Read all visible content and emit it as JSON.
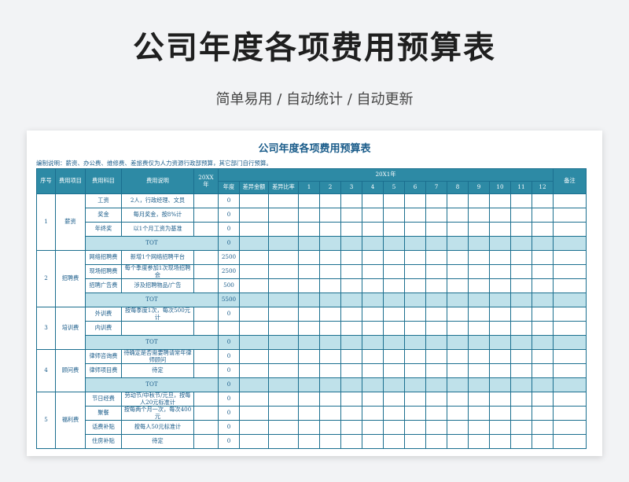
{
  "hero": {
    "title": "公司年度各项费用预算表",
    "subtitle": "简单易用  /  自动统计  /  自动更新"
  },
  "sheet": {
    "title": "公司年度各项费用预算表",
    "note": "编制说明：薪资、办公费、维修费、差旅费仅为人力资源行政部预算，其它部门自行预算。",
    "headers": {
      "seq": "序号",
      "project": "费用项目",
      "subject": "费用科目",
      "desc": "费用说明",
      "prev_year": "20XX年",
      "cur_year": "20X1年",
      "remark": "备注",
      "annual": "年度",
      "diff_amount": "差异金额",
      "diff_ratio": "差异比率",
      "months": [
        "1",
        "2",
        "3",
        "4",
        "5",
        "6",
        "7",
        "8",
        "9",
        "10",
        "11",
        "12"
      ]
    },
    "groups": [
      {
        "seq": "1",
        "project": "薪资",
        "items": [
          {
            "subject": "工资",
            "desc": "2人，行政经理、文员",
            "annual": "0"
          },
          {
            "subject": "奖金",
            "desc": "每月奖金，按8%计",
            "annual": "0"
          },
          {
            "subject": "年终奖",
            "desc": "以1个月工资为基准",
            "annual": "0"
          }
        ],
        "tot_label": "TOT",
        "tot_value": "0"
      },
      {
        "seq": "2",
        "project": "招聘费",
        "items": [
          {
            "subject": "网络招聘费",
            "desc": "新增1个网络招聘平台",
            "annual": "2500"
          },
          {
            "subject": "现场招聘费",
            "desc": "每个季度参加1次现场招聘会",
            "annual": "2500"
          },
          {
            "subject": "招聘广告费",
            "desc": "涉及招聘物品/广告",
            "annual": "500"
          }
        ],
        "tot_label": "TOT",
        "tot_value": "5500"
      },
      {
        "seq": "3",
        "project": "培训费",
        "items": [
          {
            "subject": "外训费",
            "desc": "按每季度1次，每次500元计",
            "annual": "0"
          },
          {
            "subject": "内训费",
            "desc": "",
            "annual": ""
          }
        ],
        "tot_label": "TOT",
        "tot_value": "0"
      },
      {
        "seq": "4",
        "project": "顾问费",
        "items": [
          {
            "subject": "律师咨询费",
            "desc": "待确定是否需要聘请常年律师顾问",
            "annual": "0"
          },
          {
            "subject": "律师项目费",
            "desc": "待定",
            "annual": "0"
          }
        ],
        "tot_label": "TOT",
        "tot_value": "0"
      },
      {
        "seq": "5",
        "project": "福利费",
        "items": [
          {
            "subject": "节日经费",
            "desc": "劳动节/中秋节/元旦，按每人20元标准计",
            "annual": "0"
          },
          {
            "subject": "聚餐",
            "desc": "按每两个月一次，每次400元",
            "annual": "0"
          },
          {
            "subject": "话费补贴",
            "desc": "按每人50元标准计",
            "annual": "0"
          },
          {
            "subject": "住房补贴",
            "desc": "待定",
            "annual": "0"
          }
        ]
      }
    ]
  }
}
